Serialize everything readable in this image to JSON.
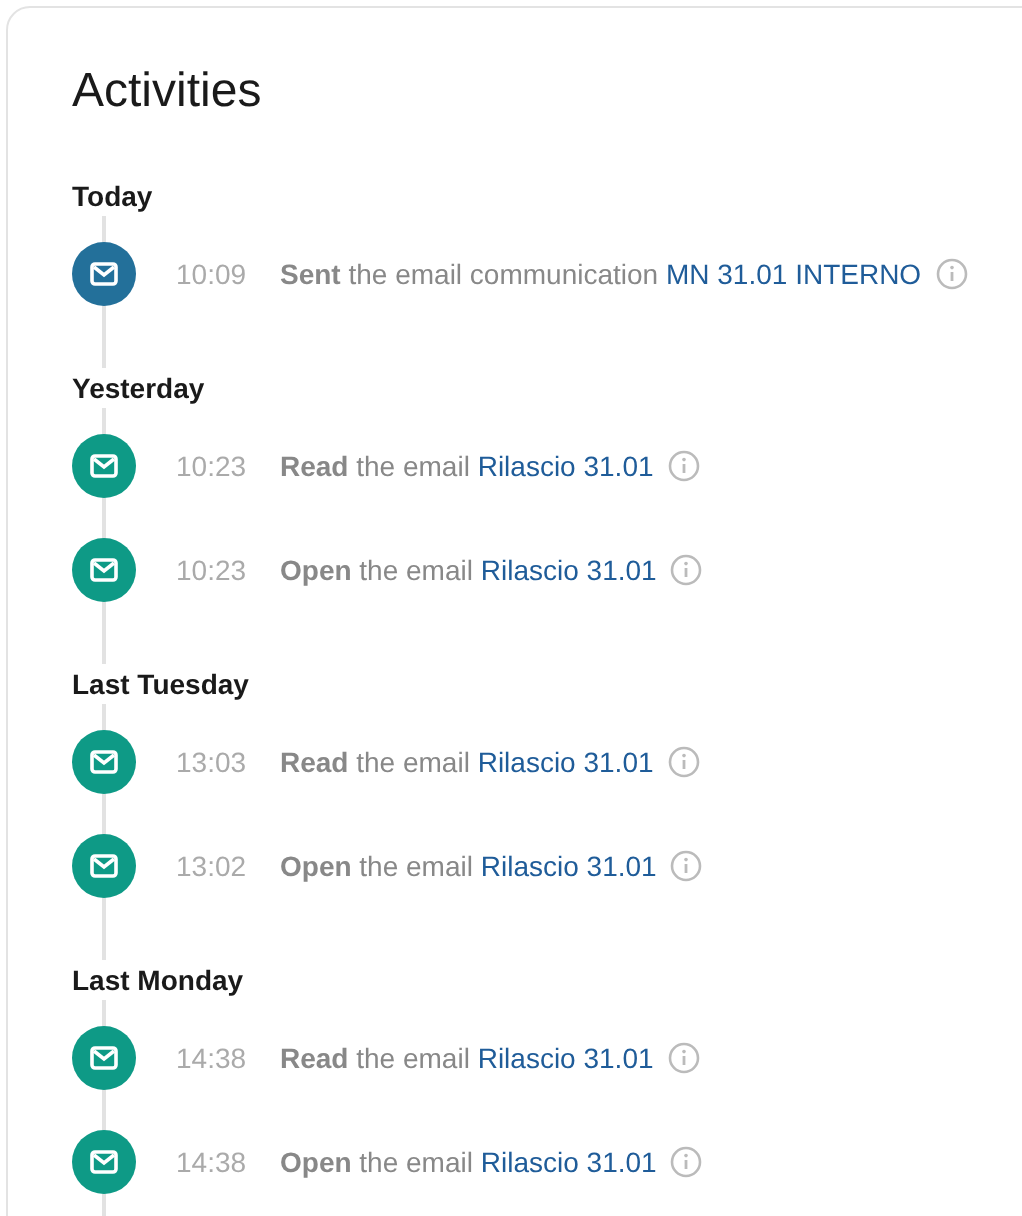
{
  "title": "Activities",
  "groups": [
    {
      "label": "Today",
      "events": [
        {
          "time": "10:09",
          "text": "**Sent** the email communication",
          "link": "MN 31.01 INTERNO",
          "color": "#23709a"
        }
      ]
    },
    {
      "label": "Yesterday",
      "events": [
        {
          "time": "10:23",
          "text": "**Read** the email",
          "link": "Rilascio 31.01",
          "color": "#0e9a86"
        },
        {
          "time": "10:23",
          "text": "**Open** the email",
          "link": "Rilascio 31.01",
          "color": "#0e9a86"
        }
      ]
    },
    {
      "label": "Last Tuesday",
      "events": [
        {
          "time": "13:03",
          "text": "**Read** the email",
          "link": "Rilascio 31.01",
          "color": "#0e9a86"
        },
        {
          "time": "13:02",
          "text": "**Open** the email",
          "link": "Rilascio 31.01",
          "color": "#0e9a86"
        }
      ]
    },
    {
      "label": "Last Monday",
      "events": [
        {
          "time": "14:38",
          "text": "**Read** the email",
          "link": "Rilascio 31.01",
          "color": "#0e9a86"
        },
        {
          "time": "14:38",
          "text": "**Open** the email",
          "link": "Rilascio 31.01",
          "color": "#0e9a86"
        }
      ]
    }
  ]
}
